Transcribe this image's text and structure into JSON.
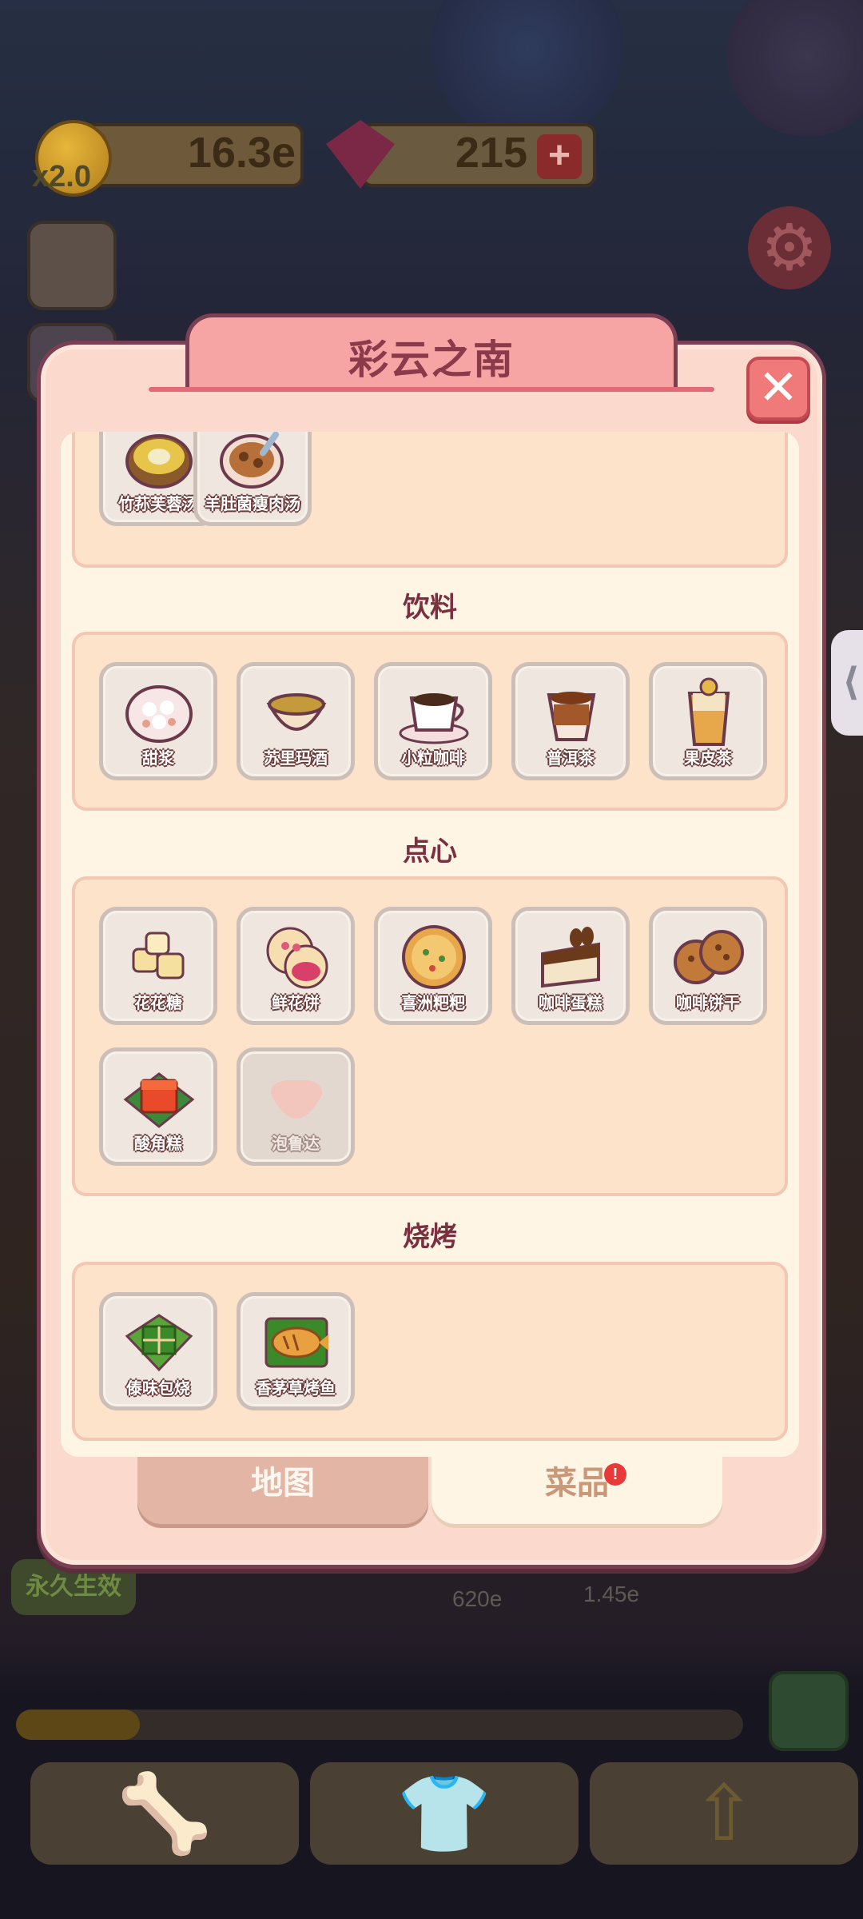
{
  "hud": {
    "coins": "16.3e",
    "multiplier": "x2.0",
    "gems": "215",
    "gem_add": "+"
  },
  "background": {
    "permanent_label": "永久生效",
    "price_1": "620e",
    "price_2": "1.45e",
    "progress_fraction": 0.17
  },
  "modal": {
    "title": "彩云之南",
    "close_symbol": "✕",
    "categories": [
      {
        "title": "",
        "items": [
          {
            "name": "竹荪芙蓉汤",
            "icon": "soup-bowl-icon",
            "locked": false
          },
          {
            "name": "羊肚菌瘦肉汤",
            "icon": "soup-spoon-icon",
            "locked": false
          }
        ]
      },
      {
        "title": "饮料",
        "items": [
          {
            "name": "甜浆",
            "icon": "sweet-soup-icon",
            "locked": false
          },
          {
            "name": "苏里玛酒",
            "icon": "wine-bowl-icon",
            "locked": false
          },
          {
            "name": "小粒咖啡",
            "icon": "coffee-cup-icon",
            "locked": false
          },
          {
            "name": "普洱茶",
            "icon": "tea-cup-icon",
            "locked": false
          },
          {
            "name": "果皮茶",
            "icon": "fruit-tea-icon",
            "locked": false
          }
        ]
      },
      {
        "title": "点心",
        "items": [
          {
            "name": "花花糖",
            "icon": "candy-icon",
            "locked": false
          },
          {
            "name": "鲜花饼",
            "icon": "flower-cake-icon",
            "locked": false
          },
          {
            "name": "喜洲粑粑",
            "icon": "flatbread-icon",
            "locked": false
          },
          {
            "name": "咖啡蛋糕",
            "icon": "coffee-cake-icon",
            "locked": false
          },
          {
            "name": "咖啡饼干",
            "icon": "cookie-icon",
            "locked": false
          },
          {
            "name": "酸角糕",
            "icon": "jelly-cake-icon",
            "locked": false
          },
          {
            "name": "泡鲁达",
            "icon": "locked-dish-icon",
            "locked": true
          }
        ]
      },
      {
        "title": "烧烤",
        "items": [
          {
            "name": "傣味包烧",
            "icon": "leaf-wrap-icon",
            "locked": false
          },
          {
            "name": "香茅草烤鱼",
            "icon": "grilled-fish-icon",
            "locked": false
          }
        ]
      }
    ],
    "tabs": {
      "map": "地图",
      "dishes": "菜品",
      "badge": "!"
    }
  },
  "colors": {
    "modal_bg": "#fbd9cc",
    "title_tab": "#f6a4a4",
    "title_text": "#8a3a4a",
    "close_button": "#f07a7a",
    "section_title": "#7a3040",
    "badge": "#e83a3a"
  }
}
